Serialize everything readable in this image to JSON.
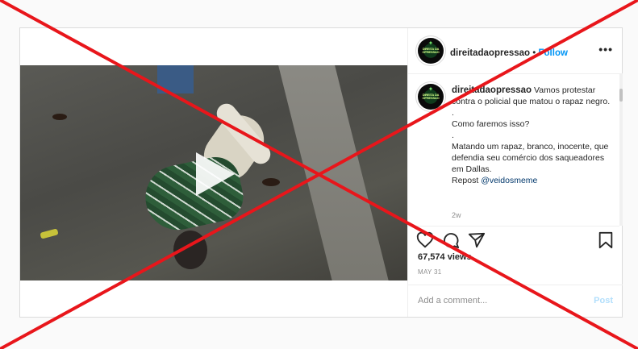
{
  "post": {
    "username": "direitadaopressao",
    "separator": " • ",
    "follow_label": "Follow",
    "more_label": "•••",
    "avatar_text": "DIREITA DA OPRESSAO",
    "caption_lines": [
      "Vamos protestar contra o policial que matou o rapaz negro.",
      ".",
      "Como faremos isso?",
      ".",
      "Matando um rapaz, branco, inocente, que defendia seu comércio dos saqueadores em Dallas.",
      "Repost "
    ],
    "mention": "@veidosmeme",
    "age": "2w",
    "views": "67,574 views",
    "date": "MAY 31",
    "comment_placeholder": "Add a comment...",
    "post_label": "Post"
  },
  "icons": {
    "like": "heart-icon",
    "comment": "comment-bubble-icon",
    "share": "paper-plane-icon",
    "save": "bookmark-icon",
    "play": "play-icon"
  },
  "colors": {
    "cross": "#e8161b",
    "follow": "#0095f6",
    "post_disabled": "#b2dffc"
  }
}
